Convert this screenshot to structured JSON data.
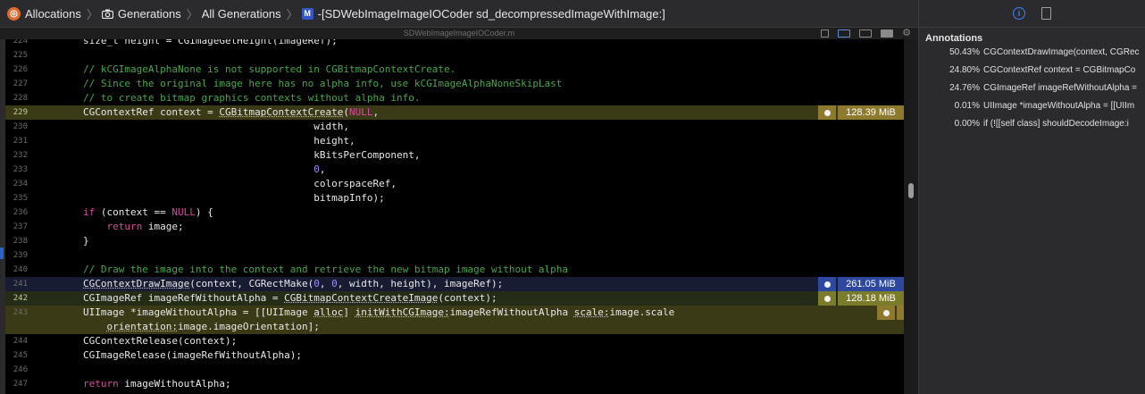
{
  "breadcrumb": {
    "items": [
      {
        "icon": "allocations-icon",
        "label": "Allocations"
      },
      {
        "icon": "camera-icon",
        "label": "Generations"
      },
      {
        "label": "All Generations"
      },
      {
        "icon": "method-icon",
        "icon_letter": "M",
        "label": "-[SDWebImageImageIOCoder sd_decompressedImageWithImage:]"
      }
    ]
  },
  "editor": {
    "filename": "SDWebImageImageIOCoder.m",
    "lines": [
      {
        "num": "224",
        "tokens": [
          {
            "t": "size_t height = CGImageGetHeight(imageRef);"
          }
        ]
      },
      {
        "num": "225",
        "tokens": []
      },
      {
        "num": "226",
        "tokens": [
          {
            "t": "// kCGImageAlphaNone is not supported in CGBitmapContextCreate.",
            "c": "comment"
          }
        ]
      },
      {
        "num": "227",
        "tokens": [
          {
            "t": "// Since the original image here has no alpha info, use kCGImageAlphaNoneSkipLast",
            "c": "comment"
          }
        ]
      },
      {
        "num": "228",
        "tokens": [
          {
            "t": "// to create bitmap graphics contexts without alpha info.",
            "c": "comment"
          }
        ]
      },
      {
        "num": "229",
        "hl": "yellow",
        "tokens": [
          {
            "t": "CGContextRef context = "
          },
          {
            "t": "CGBitmapContextCreate",
            "c": "ul"
          },
          {
            "t": "("
          },
          {
            "t": "NULL",
            "c": "kw"
          },
          {
            "t": ","
          }
        ]
      },
      {
        "num": "230",
        "tokens": [
          {
            "t": "                                       width,"
          }
        ]
      },
      {
        "num": "231",
        "tokens": [
          {
            "t": "                                       height,"
          }
        ]
      },
      {
        "num": "232",
        "tokens": [
          {
            "t": "                                       kBitsPerComponent,"
          }
        ]
      },
      {
        "num": "233",
        "tokens": [
          {
            "t": "                                       "
          },
          {
            "t": "0",
            "c": "num"
          },
          {
            "t": ","
          }
        ]
      },
      {
        "num": "234",
        "tokens": [
          {
            "t": "                                       colorspaceRef,"
          }
        ]
      },
      {
        "num": "235",
        "tokens": [
          {
            "t": "                                       bitmapInfo);"
          }
        ]
      },
      {
        "num": "236",
        "tokens": [
          {
            "t": "if",
            "c": "kw"
          },
          {
            "t": " (context == "
          },
          {
            "t": "NULL",
            "c": "kw"
          },
          {
            "t": ") {"
          }
        ]
      },
      {
        "num": "237",
        "tokens": [
          {
            "t": "    "
          },
          {
            "t": "return",
            "c": "kw"
          },
          {
            "t": " image;"
          }
        ]
      },
      {
        "num": "238",
        "tokens": [
          {
            "t": "}"
          }
        ]
      },
      {
        "num": "239",
        "tokens": []
      },
      {
        "num": "240",
        "tokens": [
          {
            "t": "// Draw the image into the context and retrieve the new bitmap image without alpha",
            "c": "comment"
          }
        ]
      },
      {
        "num": "241",
        "hl": "blue",
        "tokens": [
          {
            "t": "CGContextDrawImage",
            "c": "ul"
          },
          {
            "t": "(context, CGRectMake("
          },
          {
            "t": "0",
            "c": "num"
          },
          {
            "t": ", "
          },
          {
            "t": "0",
            "c": "num"
          },
          {
            "t": ", width, height), imageRef);"
          }
        ]
      },
      {
        "num": "242",
        "hl": "green",
        "tokens": [
          {
            "t": "CGImageRef imageRefWithoutAlpha = "
          },
          {
            "t": "CGBitmapContextCreateImage",
            "c": "ul"
          },
          {
            "t": "(context);"
          }
        ]
      },
      {
        "num": "243",
        "hl": "yellow",
        "tokens": [
          {
            "t": "UIImage *imageWithoutAlpha = [[UIImage "
          },
          {
            "t": "alloc",
            "c": "ul"
          },
          {
            "t": "] "
          },
          {
            "t": "initWithCGImage:",
            "c": "ul"
          },
          {
            "t": "imageRefWithoutAlpha "
          },
          {
            "t": "scale:",
            "c": "ul"
          },
          {
            "t": "image.scale"
          }
        ]
      },
      {
        "num": "",
        "hl": "yellow",
        "tokens": [
          {
            "t": "    "
          },
          {
            "t": "orientation:",
            "c": "ul"
          },
          {
            "t": "image.imageOrientation];"
          }
        ]
      },
      {
        "num": "244",
        "tokens": [
          {
            "t": "CGContextRelease(context);"
          }
        ]
      },
      {
        "num": "245",
        "tokens": [
          {
            "t": "CGImageRelease(imageRefWithoutAlpha);"
          }
        ]
      },
      {
        "num": "246",
        "tokens": []
      },
      {
        "num": "247",
        "tokens": [
          {
            "t": "return",
            "c": "kw"
          },
          {
            "t": " imageWithoutAlpha;"
          }
        ]
      }
    ],
    "badges": [
      {
        "line": "229",
        "value": "128.39 MiB",
        "color": "#8e7a2e"
      },
      {
        "line": "241",
        "value": "261.05 MiB",
        "color": "#2e48a0"
      },
      {
        "line": "242",
        "value": "128.18 MiB",
        "color": "#7a7c2a"
      },
      {
        "line": "243",
        "value": "",
        "color": "#8e7a2e"
      }
    ]
  },
  "annotations": {
    "title": "Annotations",
    "items": [
      {
        "pct": "50.43%",
        "text": "CGContextDrawImage(context, CGRec"
      },
      {
        "pct": "24.80%",
        "text": "CGContextRef context = CGBitmapCo"
      },
      {
        "pct": "24.76%",
        "text": "CGImageRef imageRefWithoutAlpha ="
      },
      {
        "pct": "0.01%",
        "text": "UIImage *imageWithoutAlpha = [[UIIm"
      },
      {
        "pct": "0.00%",
        "text": "if (![[self class] shouldDecodeImage:i"
      }
    ]
  }
}
